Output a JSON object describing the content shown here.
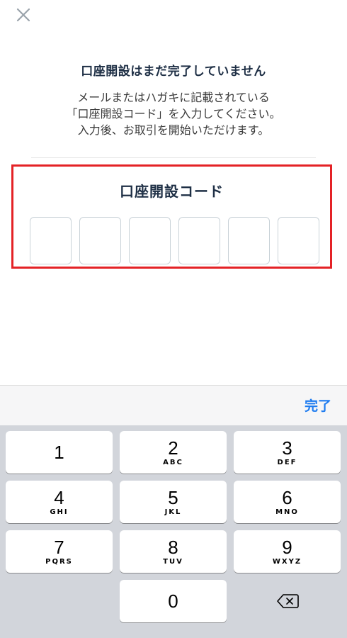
{
  "header": {
    "close_icon": "close-icon"
  },
  "intro": {
    "title": "口座開設はまだ完了していません",
    "line1": "メールまたはハガキに記載されている",
    "line2": "「口座開設コード」を入力してください。",
    "line3": "入力後、お取引を開始いただけます。"
  },
  "code": {
    "title": "口座開設コード",
    "digits": [
      "",
      "",
      "",
      "",
      "",
      ""
    ]
  },
  "toolbar": {
    "done_label": "完了",
    "done_color": "#1e7cf0"
  },
  "keypad": {
    "keys": [
      {
        "num": "1",
        "letters": ""
      },
      {
        "num": "2",
        "letters": "ABC"
      },
      {
        "num": "3",
        "letters": "DEF"
      },
      {
        "num": "4",
        "letters": "GHI"
      },
      {
        "num": "5",
        "letters": "JKL"
      },
      {
        "num": "6",
        "letters": "MNO"
      },
      {
        "num": "7",
        "letters": "PQRS"
      },
      {
        "num": "8",
        "letters": "TUV"
      },
      {
        "num": "9",
        "letters": "WXYZ"
      },
      {
        "num": "0",
        "letters": ""
      }
    ],
    "delete_icon": "backspace-icon"
  },
  "colors": {
    "highlight_border": "#e42226",
    "title_text": "#1e2f45",
    "keyboard_bg": "#d2d5db"
  }
}
